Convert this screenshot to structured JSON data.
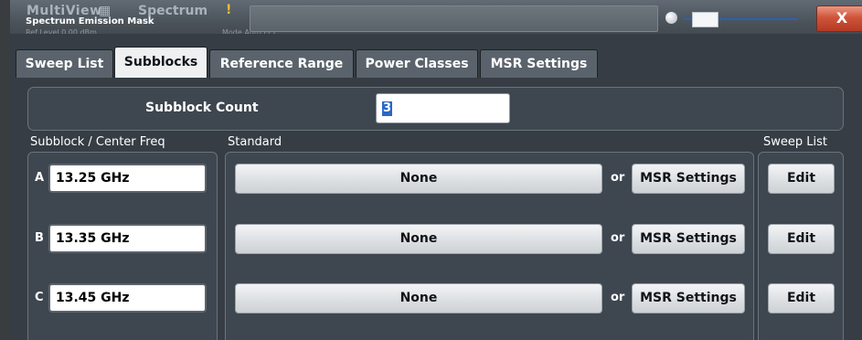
{
  "window": {
    "app_name": "MultiView",
    "mode_name": "Spectrum",
    "warning_glyph": "!",
    "title": "Spectrum Emission Mask",
    "ref_level": "Ref Level 0.00 dBm",
    "mode_text": "Mode Auto FFT",
    "close_label": "X"
  },
  "tabs": [
    {
      "label": "Sweep List",
      "active": false
    },
    {
      "label": "Subblocks",
      "active": true
    },
    {
      "label": "Reference Range",
      "active": false
    },
    {
      "label": "Power Classes",
      "active": false
    },
    {
      "label": "MSR Settings",
      "active": false
    }
  ],
  "subblock_count": {
    "label": "Subblock Count",
    "value": "3"
  },
  "headers": {
    "center_freq": "Subblock / Center Freq",
    "standard": "Standard",
    "sweep_list": "Sweep List"
  },
  "rows": [
    {
      "letter": "A",
      "freq": "13.25 GHz",
      "standard": "None",
      "or": "or",
      "msr": "MSR Settings",
      "edit": "Edit"
    },
    {
      "letter": "B",
      "freq": "13.35 GHz",
      "standard": "None",
      "or": "or",
      "msr": "MSR Settings",
      "edit": "Edit"
    },
    {
      "letter": "C",
      "freq": "13.45 GHz",
      "standard": "None",
      "or": "or",
      "msr": "MSR Settings",
      "edit": "Edit"
    }
  ],
  "colors": {
    "background": "#363d44",
    "panel": "#3e4650",
    "selection": "#2a67c8",
    "close_button": "#d0543a"
  }
}
